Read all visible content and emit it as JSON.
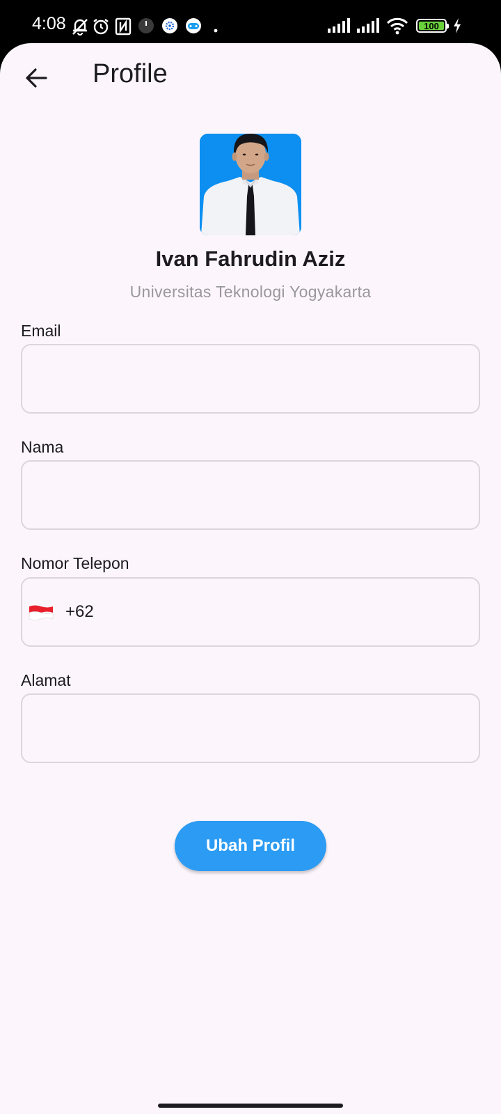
{
  "status_bar": {
    "time": "4:08",
    "battery": "100",
    "icons": [
      "mute-bell-icon",
      "alarm-icon",
      "nfc-icon",
      "clock-app-icon",
      "settings-app-icon",
      "game-app-icon",
      "dot-icon",
      "signal-1-icon",
      "signal-2-icon",
      "wifi-icon",
      "battery-icon",
      "charging-icon"
    ]
  },
  "app_bar": {
    "title": "Profile",
    "back_icon": "arrow-back-icon"
  },
  "profile": {
    "name": "Ivan Fahrudin Aziz",
    "university": "Universitas Teknologi Yogyakarta",
    "photo_bg": "#0c8ff0"
  },
  "form": {
    "email_label": "Email",
    "email_value": "",
    "nama_label": "Nama",
    "nama_value": "",
    "phone_label": "Nomor Telepon",
    "phone_flag": "indonesia-flag-icon",
    "phone_code": "+62",
    "alamat_label": "Alamat",
    "alamat_value": ""
  },
  "actions": {
    "update_label": "Ubah Profil"
  },
  "colors": {
    "background": "#fcf6fc",
    "primary_button": "#2b9bf3",
    "input_border": "#dcd6dc",
    "subtitle": "#9a979c"
  }
}
